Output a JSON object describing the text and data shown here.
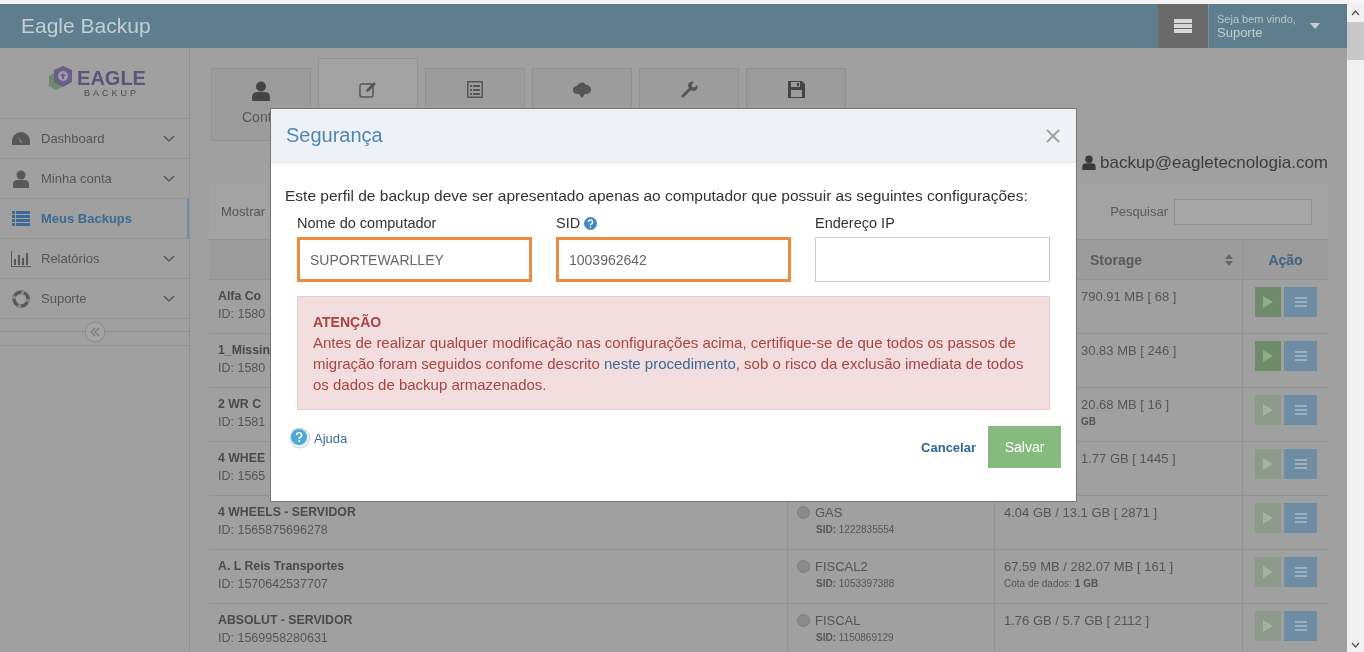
{
  "header": {
    "title": "Eagle Backup",
    "welcome": "Seja bem vindo,",
    "user": "Suporte"
  },
  "sidebar": {
    "logo": {
      "name": "EAGLE",
      "tagline": "BACKUP"
    },
    "items": [
      {
        "label": "Dashboard",
        "selected": false
      },
      {
        "label": "Minha conta",
        "selected": false
      },
      {
        "label": "Meus Backups",
        "selected": true
      },
      {
        "label": "Relatórios",
        "selected": false
      },
      {
        "label": "Suporte",
        "selected": false
      }
    ]
  },
  "tiles": [
    {
      "label": "Cont",
      "selected": false
    },
    {
      "selected": true
    },
    {
      "selected": false
    },
    {
      "selected": false
    },
    {
      "selected": false
    },
    {
      "selected": false
    }
  ],
  "account": {
    "email": "backup@eagletecnologia.com"
  },
  "table": {
    "show_label": "Mostrar",
    "search_label": "Pesquisar",
    "columns": {
      "storage": "Storage",
      "action": "Ação"
    },
    "rows": [
      {
        "name": "Alfa Co",
        "id": "ID: 1580",
        "storage": "790.91 MB [ 68 ]",
        "play_enabled": true
      },
      {
        "name": "1_Missin",
        "id": "ID: 1580",
        "storage": "30.83 MB [ 246 ]",
        "play_enabled": true
      },
      {
        "name": "2 WR C",
        "id": "ID: 1581",
        "storage": "20.68 MB [ 16 ]",
        "quota": {
          "value": "GB"
        },
        "play_enabled": false
      },
      {
        "name": "4 WHEE",
        "id": "ID: 1565",
        "storage": "1.77 GB [ 1445 ]",
        "play_enabled": false
      },
      {
        "name": "4 WHEELS - SERVIDOR",
        "id": "ID: 1565875696278",
        "device": "GAS",
        "sid": "**SID:** 1222835554",
        "storage": "4.04 GB / 13.1 GB [ 2871 ]",
        "play_enabled": false
      },
      {
        "name": "A. L Reis Transportes",
        "id": "ID: 1570642537707",
        "device": "FISCAL2",
        "sid": "**SID:** 1053397388",
        "storage": "67.59 MB / 282.07 MB [ 161 ]",
        "quota": {
          "label": "Cota de dados:",
          "value": "1 GB"
        },
        "play_enabled": false
      },
      {
        "name": "ABSOLUT - SERVIDOR",
        "id": "ID: 1569958280631",
        "device": "FISCAL",
        "sid": "**SID:** 1150869129",
        "storage": "1.76 GB / 5.7 GB [ 2112 ]",
        "play_enabled": false
      }
    ]
  },
  "modal": {
    "title": "Segurança",
    "intro": "Este perfil de backup deve ser apresentado apenas ao computador que possuir as seguintes configurações:",
    "fields": [
      {
        "label": "Nome do computador",
        "value": "SUPORTEWARLLEY",
        "highlighted": true,
        "help": false
      },
      {
        "label": "SID",
        "value": "1003962642",
        "highlighted": true,
        "help": true
      },
      {
        "label": "Endereço IP",
        "highlighted": false,
        "help": false
      }
    ],
    "alert": {
      "title": "ATENÇÃO",
      "text_before": "Antes de realizar qualquer modificação nas configurações acima, certifique-se de que todos os passos de migração foram seguidos confome descrito",
      "link": "neste procedimento",
      "text_after": ", sob o risco da exclusão imediata de todos os dados de backup armazenados."
    },
    "help_link": "Ajuda",
    "cancel": "Cancelar",
    "save": "Salvar"
  }
}
